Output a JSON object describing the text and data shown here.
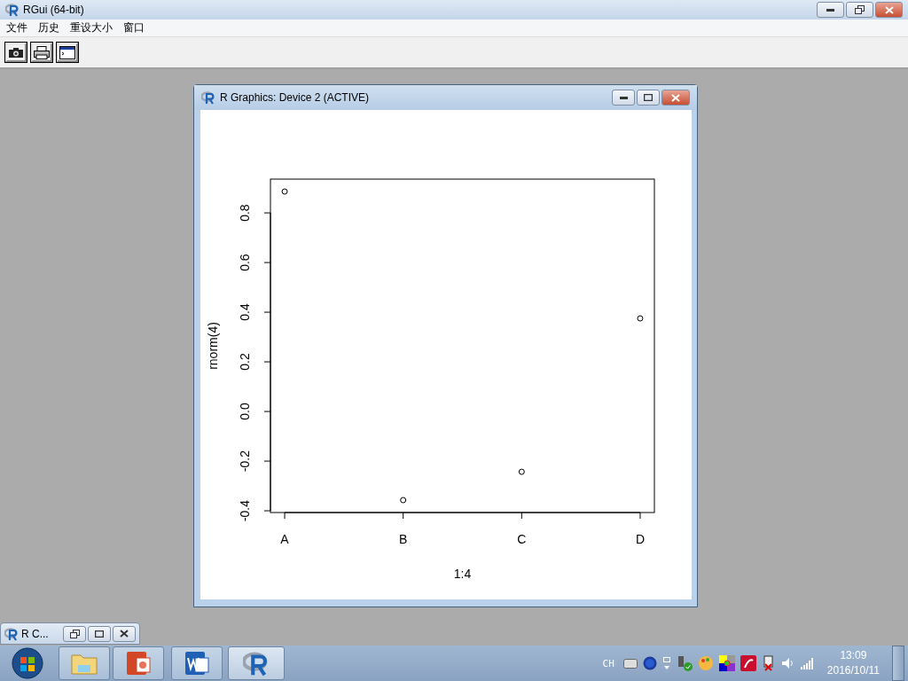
{
  "main_window": {
    "title": "RGui (64-bit)",
    "menu": [
      "文件",
      "历史",
      "重设大小",
      "窗口"
    ]
  },
  "graphics_window": {
    "title": "R Graphics: Device 2 (ACTIVE)",
    "chart_data": {
      "type": "scatter",
      "xlabel": "1:4",
      "ylabel": "rnorm(4)",
      "categories": [
        "A",
        "B",
        "C",
        "D"
      ],
      "ylim": [
        -0.407,
        0.936
      ],
      "yticks": [
        {
          "value": -0.4,
          "label": "-0.4"
        },
        {
          "value": -0.2,
          "label": "-0.2"
        },
        {
          "value": 0,
          "label": "0.0"
        },
        {
          "value": 0.2,
          "label": "0.2"
        },
        {
          "value": 0.4,
          "label": "0.4"
        },
        {
          "value": 0.6,
          "label": "0.6"
        },
        {
          "value": 0.8,
          "label": "0.8"
        }
      ],
      "series": [
        {
          "color": "#000000",
          "values": [
            0.886,
            -0.357,
            -0.243,
            0.375
          ]
        }
      ]
    }
  },
  "minimized_window": {
    "title": "R C..."
  },
  "tray": {
    "language": "CH",
    "time": "13:09",
    "date": "2016/10/11"
  }
}
